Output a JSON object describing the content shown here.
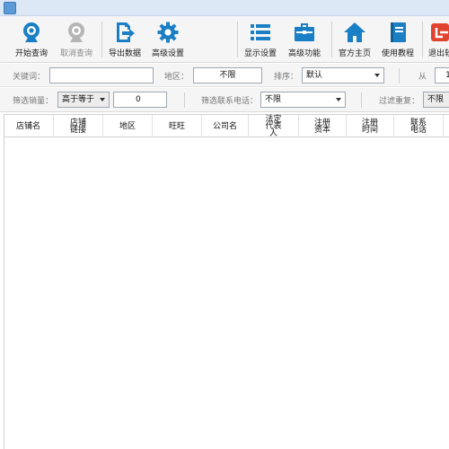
{
  "titlebar": {
    "icon_text": ""
  },
  "toolbar": {
    "start_query": "开始查询",
    "cancel_query": "取消查询",
    "export_data": "导出数据",
    "advanced_settings": "高级设置",
    "display_settings": "显示设置",
    "advanced_features": "高级功能",
    "official_home": "官方主页",
    "tutorial": "使用教程",
    "exit": "退出软"
  },
  "filters": {
    "keyword_label": "关键词：",
    "keyword_value": "",
    "region_label": "地区：",
    "region_value": "不限",
    "sort_label": "排序：",
    "sort_value": "默认",
    "from_label": "从",
    "from_value": "1",
    "sales_label": "筛选销量：",
    "sales_op": "高于等于",
    "sales_value": "0",
    "phone_label": "筛选联系电话：",
    "phone_value": "不限",
    "dedupe_label": "过滤重复：",
    "dedupe_value": "不限"
  },
  "table": {
    "columns": [
      "店铺名",
      "店铺链接",
      "地区",
      "旺旺",
      "公司名",
      "法定代表人",
      "注册资本",
      "注册时间",
      "联系电话"
    ],
    "rows": []
  },
  "colors": {
    "accent": "#1a7fc4",
    "red": "#e0432f",
    "titlebar": "#dce8f6",
    "toolbar_bg": "#f5f5f5"
  }
}
